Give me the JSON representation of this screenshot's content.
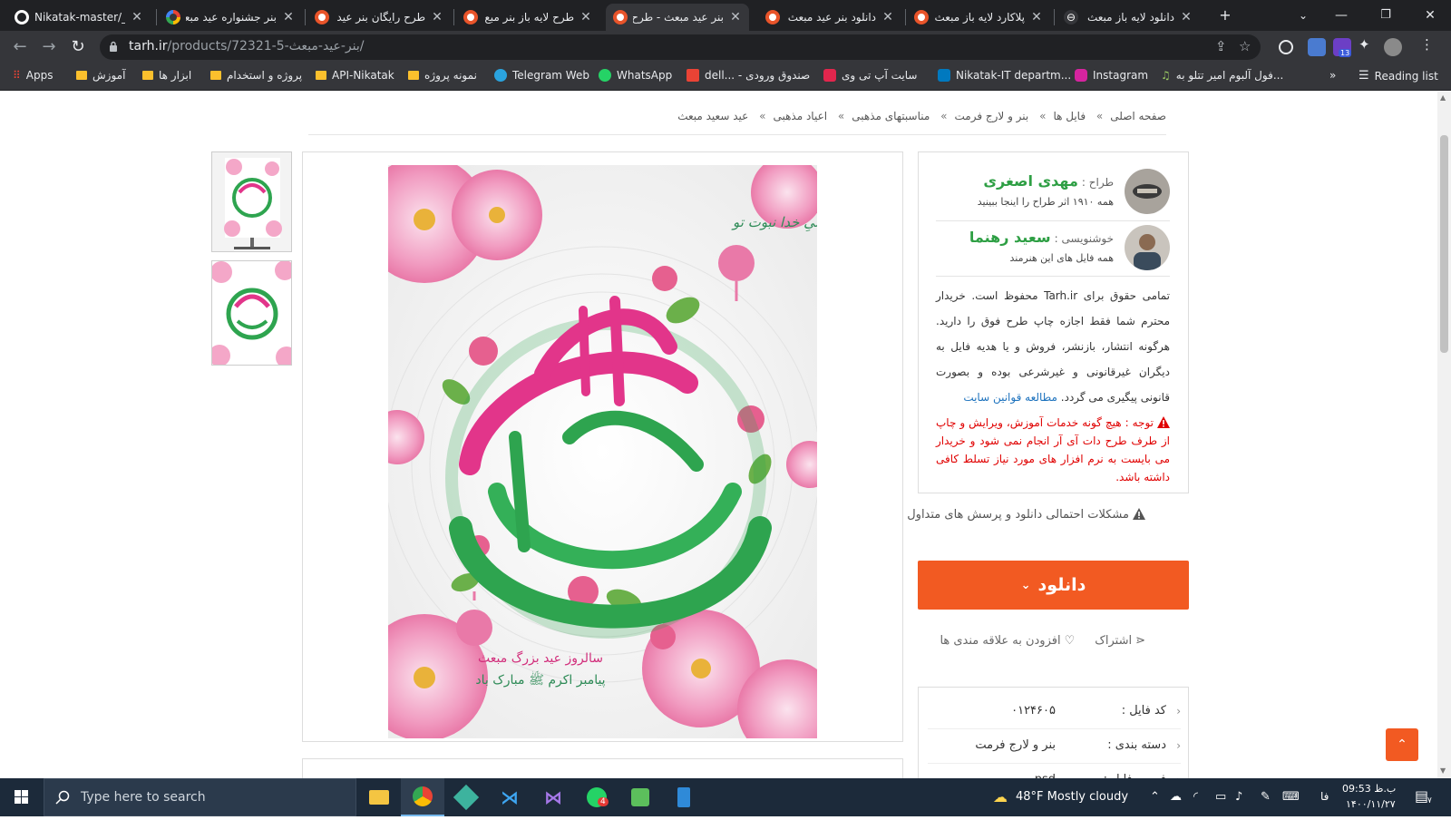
{
  "tabs": [
    {
      "title": "Nikatak-master/_La",
      "icon": "github-icon",
      "rtl": false,
      "active": false
    },
    {
      "title": "بنر جشنواره عید مبعث",
      "icon": "google-icon",
      "rtl": true,
      "active": false
    },
    {
      "title": "طرح رایگان بنر عید",
      "icon": "tarh-icon",
      "rtl": true,
      "active": false
    },
    {
      "title": "طرح لایه باز بنر مبع",
      "icon": "tarh-icon",
      "rtl": true,
      "active": false
    },
    {
      "title": "بنر عید مبعث - طرح",
      "icon": "tarh-icon",
      "rtl": true,
      "active": true
    },
    {
      "title": "دانلود بنر عید مبعث",
      "icon": "tarh-icon",
      "rtl": true,
      "active": false
    },
    {
      "title": "پلاکارد لایه باز مبعث",
      "icon": "tarh-icon",
      "rtl": true,
      "active": false
    },
    {
      "title": "دانلود لایه باز مبعث",
      "icon": "tarh-icon",
      "rtl": true,
      "active": false
    }
  ],
  "address": {
    "host": "tarh.ir",
    "path": "/products/72321-5-بنر-عید-مبعث/"
  },
  "extensions_badge": "13",
  "bookmarks": [
    {
      "label": "Apps",
      "type": "apps"
    },
    {
      "label": "آموزش",
      "type": "folder"
    },
    {
      "label": "ابزار ها",
      "type": "folder"
    },
    {
      "label": "پروژه و استخدام",
      "type": "folder"
    },
    {
      "label": "API-Nikatak",
      "type": "folder"
    },
    {
      "label": "نمونه پروژه",
      "type": "folder"
    },
    {
      "label": "Telegram Web",
      "type": "telegram"
    },
    {
      "label": "WhatsApp",
      "type": "whatsapp"
    },
    {
      "label": "dell... - صندوق ورودی",
      "type": "gmail"
    },
    {
      "label": "سایت آپ تی وی",
      "type": "aparat"
    },
    {
      "label": "Nikatak-IT departm...",
      "type": "trello"
    },
    {
      "label": "Instagram",
      "type": "instagram"
    },
    {
      "label": "فول آلبوم امیر تتلو به...",
      "type": "music"
    }
  ],
  "reading_list": "Reading list",
  "breadcrumb": [
    "صفحه اصلی",
    "فایل ها",
    "بنر و لارج فرمت",
    "مناسبتهای مذهبی",
    "اعیاد مذهبی",
    "عید سعید مبعث"
  ],
  "poster": {
    "top_line": "مبارک است جلیِ خدا نبوت تو",
    "bottom_line1": "سالروز عید بزرگ مبعث",
    "bottom_line2": "پیامبر اکرم ﷺ مبارک باد"
  },
  "designer": {
    "role": "طراح :",
    "name": "مهدی اصغری",
    "sub": "همه ۱۹۱۰ اثر طراح را اینجا ببینید"
  },
  "calligrapher": {
    "role": "خوشنویسی :",
    "name": "سعید رهنما",
    "sub": "همه فایل های این هنرمند"
  },
  "copyright_text": "تمامی حقوق برای Tarh.ir محفوظ است. خریدار محترم شما فقط اجازه چاپ طرح فوق را دارید. هرگونه انتشار، بازنشر، فروش و یا هدیه فایل به دیگران غیرقانونی و غیرشرعی بوده و بصورت قانونی پیگیری می گردد.",
  "rules_link": "مطالعه قوانین سایت",
  "warning_text": "توجه : هیچ گونه خدمات آموزش، ویرایش و چاپ از طرف طرح دات آی آر انجام نمی شود و خریدار می بایست به نرم افزار های مورد نیاز تسلط کافی داشته باشد.",
  "faq": "مشکلات احتمالی دانلود و پرسش های متداول",
  "download": "دانلود",
  "share": "اشتراک",
  "favorite": "افزودن به علاقه مندی ها",
  "info": [
    {
      "key": "کد فایل :",
      "value": "۰۱۲۴۶۰۵"
    },
    {
      "key": "دسته بندی :",
      "value": "بنر و لارج فرمت"
    },
    {
      "key": "فرمت فایل :",
      "value": "psd"
    }
  ],
  "taskbar": {
    "search_placeholder": "Type here to search",
    "weather": "48°F  Mostly cloudy",
    "lang": "فا",
    "time": "09:53 ب.ظ",
    "date": "۱۴۰۰/۱۱/۲۷",
    "notif_count": "۷",
    "whatsapp_badge": "4"
  },
  "colors": {
    "accent": "#f25a22",
    "author_name": "#2e9f44",
    "warning": "#e00000",
    "link": "#1e73be"
  }
}
